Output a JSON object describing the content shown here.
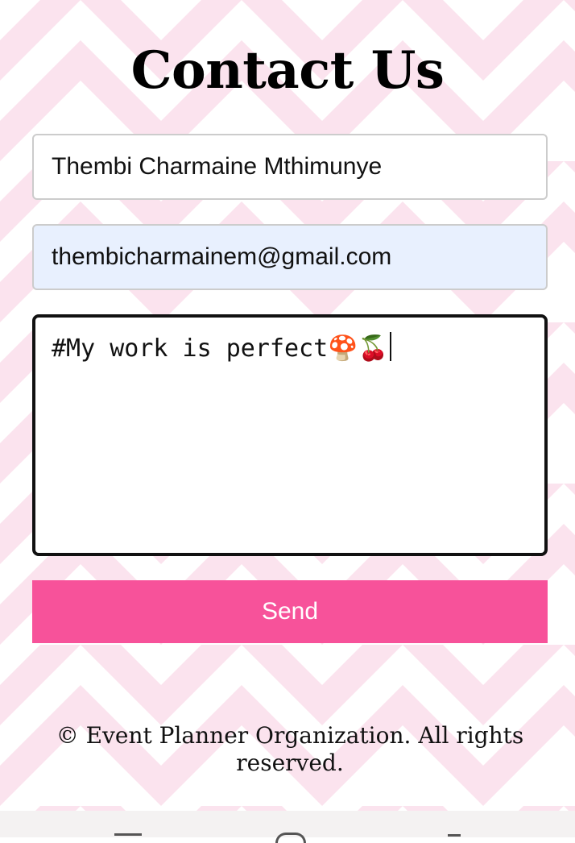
{
  "page": {
    "title": "Contact Us",
    "footer_text": "© Event Planner Organization. All rights reserved."
  },
  "form": {
    "name_value": "Thembi Charmaine Mthimunye",
    "email_value": "thembicharmainem@gmail.com",
    "message_value": "#My work is perfect🍄🍒",
    "send_label": "Send"
  },
  "colors": {
    "accent": "#f7529a",
    "background_pattern": "#fbe3ee",
    "email_autofill_bg": "#e8f0fe"
  },
  "system_nav": {
    "icons": [
      "recents-icon",
      "home-icon",
      "back-icon"
    ]
  }
}
